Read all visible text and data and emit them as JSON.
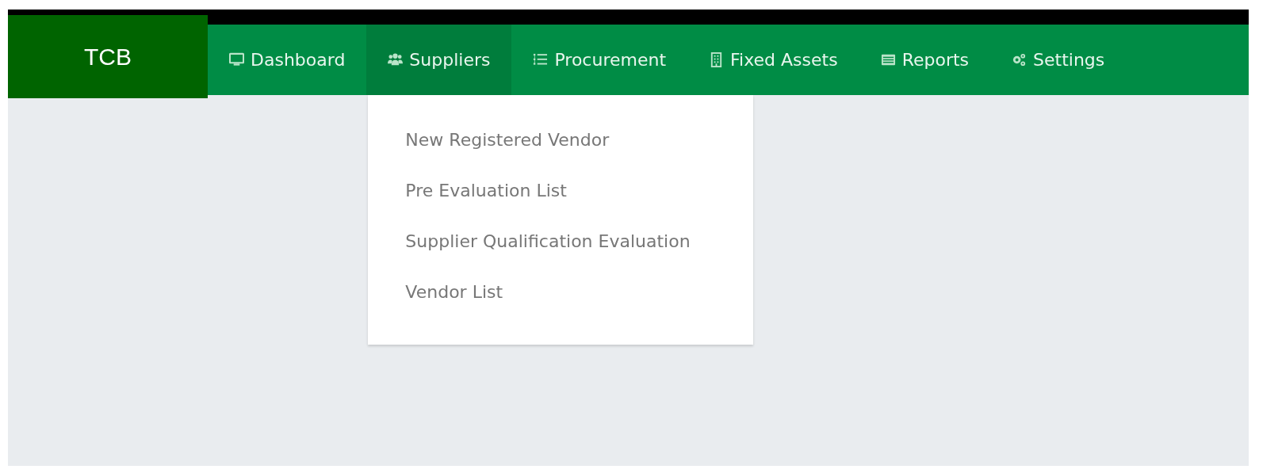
{
  "brand": "TCB",
  "nav": [
    {
      "label": "Dashboard",
      "kind": "monitor",
      "selected": false
    },
    {
      "label": "Suppliers",
      "kind": "users",
      "selected": true
    },
    {
      "label": "Procurement",
      "kind": "list",
      "selected": false
    },
    {
      "label": "Fixed Assets",
      "kind": "building",
      "selected": false
    },
    {
      "label": "Reports",
      "kind": "table",
      "selected": false
    },
    {
      "label": "Settings",
      "kind": "gears",
      "selected": false
    }
  ],
  "dropdown": {
    "items": [
      {
        "label": "New Registered Vendor"
      },
      {
        "label": "Pre Evaluation List"
      },
      {
        "label": "Supplier Qualification Evaluation"
      },
      {
        "label": "Vendor List"
      }
    ]
  }
}
